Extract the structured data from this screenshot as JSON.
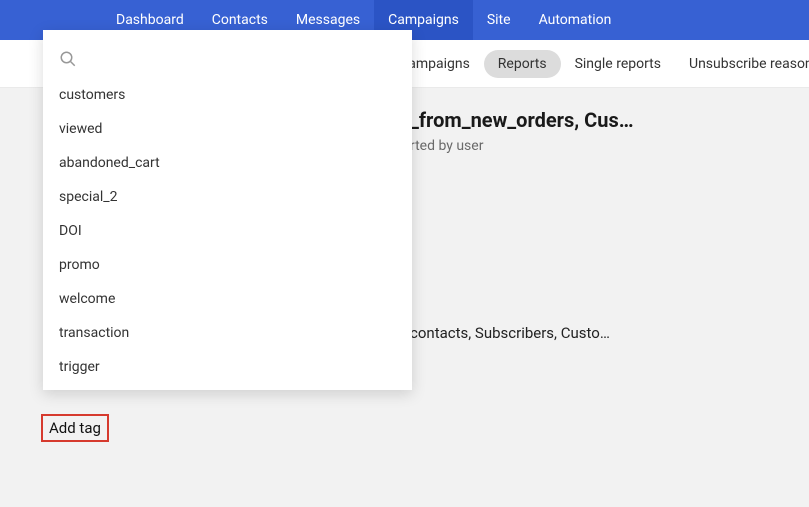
{
  "top_nav": {
    "items": [
      {
        "label": "Dashboard"
      },
      {
        "label": "Contacts"
      },
      {
        "label": "Messages"
      },
      {
        "label": "Campaigns"
      },
      {
        "label": "Site"
      },
      {
        "label": "Automation"
      }
    ]
  },
  "sub_nav": {
    "items": [
      {
        "label": "l campaigns"
      },
      {
        "label": "Reports"
      },
      {
        "label": "Single reports"
      },
      {
        "label": "Unsubscribe reasons"
      }
    ]
  },
  "page": {
    "title_fragment": "_from_new_orders, Cus…",
    "subtitle": "rted by user",
    "secondary_line": "contacts, Subscribers, Custo…"
  },
  "tag_dropdown": {
    "search_placeholder": "",
    "items": [
      {
        "label": "customers"
      },
      {
        "label": "viewed"
      },
      {
        "label": "abandoned_cart"
      },
      {
        "label": "special_2"
      },
      {
        "label": "DOI"
      },
      {
        "label": "promo"
      },
      {
        "label": "welcome"
      },
      {
        "label": "transaction"
      },
      {
        "label": "trigger"
      }
    ]
  },
  "add_tag": {
    "label": "Add tag"
  }
}
